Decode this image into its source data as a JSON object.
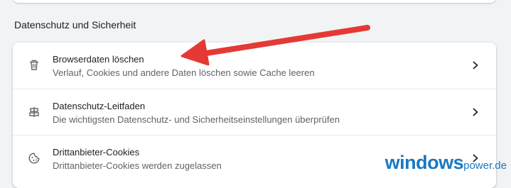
{
  "section": {
    "title": "Datenschutz und Sicherheit"
  },
  "rows": [
    {
      "icon": "trash-icon",
      "title": "Browserdaten löschen",
      "subtitle": "Verlauf, Cookies und andere Daten löschen sowie Cache leeren"
    },
    {
      "icon": "privacy-guide-icon",
      "title": "Datenschutz-Leitfaden",
      "subtitle": "Die wichtigsten Datenschutz- und Sicherheitseinstellungen überprüfen"
    },
    {
      "icon": "cookie-icon",
      "title": "Drittanbieter-Cookies",
      "subtitle": "Drittanbieter-Cookies werden zugelassen"
    }
  ],
  "annotation": {
    "arrow_color": "#e53935",
    "points_to": "Browserdaten löschen"
  },
  "watermark": {
    "main": "windows",
    "sub": "power.de"
  },
  "colors": {
    "background": "#f1f3f4",
    "card": "#ffffff",
    "text_primary": "#202124",
    "text_secondary": "#5f6368",
    "watermark": "#1a78c2"
  }
}
